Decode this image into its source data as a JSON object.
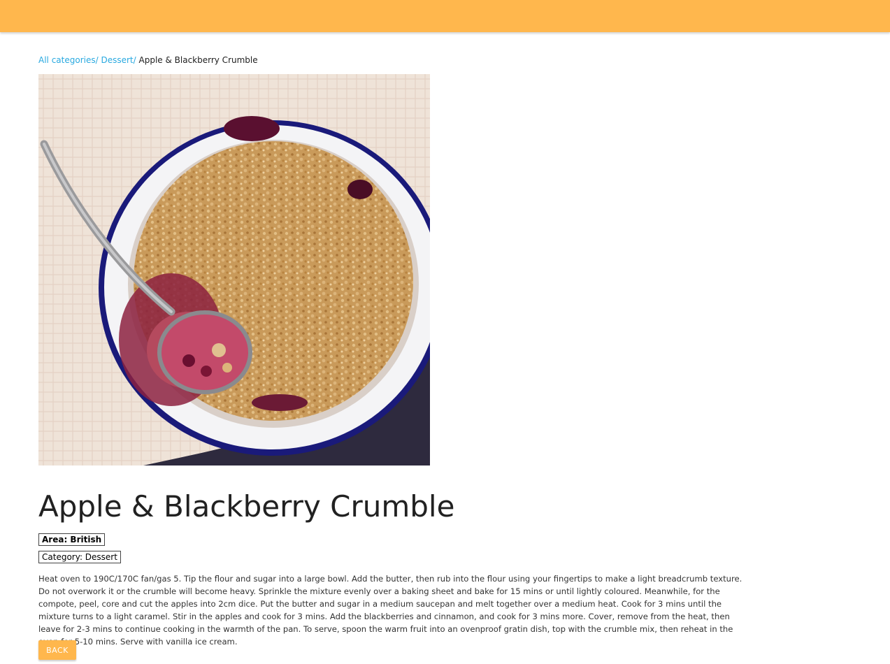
{
  "colors": {
    "header": "#ffb74d",
    "link": "#29a9e0",
    "button": "#ffb74d"
  },
  "breadcrumb": {
    "all_categories": "All categories/",
    "category": "Dessert/",
    "current": "Apple & Blackberry Crumble"
  },
  "recipe": {
    "title": "Apple & Blackberry Crumble",
    "area": "Area: British",
    "category": "Category: Dessert",
    "instructions": "Heat oven to 190C/170C fan/gas 5. Tip the flour and sugar into a large bowl. Add the butter, then rub into the flour using your fingertips to make a light breadcrumb texture. Do not overwork it or the crumble will become heavy. Sprinkle the mixture evenly over a baking sheet and bake for 15 mins or until lightly coloured. Meanwhile, for the compote, peel, core and cut the apples into 2cm dice. Put the butter and sugar in a medium saucepan and melt together over a medium heat. Cook for 3 mins until the mixture turns to a light caramel. Stir in the apples and cook for 3 mins. Add the blackberries and cinnamon, and cook for 3 mins more. Cover, remove from the heat, then leave for 2-3 mins to continue cooking in the warmth of the pan. To serve, spoon the warm fruit into an ovenproof gratin dish, top with the crumble mix, then reheat in the oven for 5-10 mins. Serve with vanilla ice cream."
  },
  "actions": {
    "back_label": "BACK"
  }
}
